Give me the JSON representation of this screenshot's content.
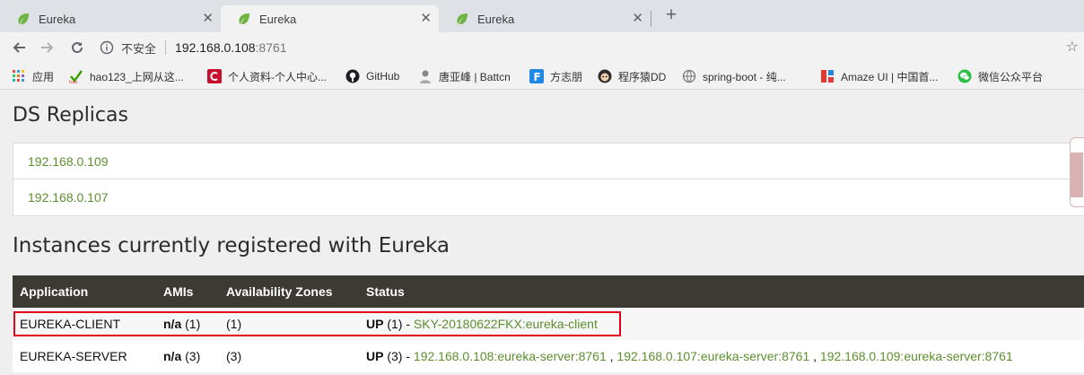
{
  "colors": {
    "accent_green": "#5d8f2e",
    "table_header_bg": "#3d3933",
    "highlight_red": "#e3001b"
  },
  "tabs": [
    {
      "title": "Eureka",
      "icon": "spring-leaf-icon"
    },
    {
      "title": "Eureka",
      "icon": "spring-leaf-icon",
      "active": true
    },
    {
      "title": "Eureka",
      "icon": "spring-leaf-icon"
    }
  ],
  "toolbar": {
    "security_label": "不安全",
    "url_host": "192.168.0.108",
    "url_port": ":8761"
  },
  "bookmarks": [
    {
      "label": "应用",
      "icon": "apps-grid-icon"
    },
    {
      "label": "hao123_上网从这...",
      "icon": "hao123-icon"
    },
    {
      "label": "个人资料-个人中心...",
      "icon": "csdn-icon"
    },
    {
      "label": "GitHub",
      "icon": "github-icon"
    },
    {
      "label": "唐亚峰 | Battcn",
      "icon": "avatar-icon"
    },
    {
      "label": "方志朋",
      "icon": "f-icon"
    },
    {
      "label": "程序猿DD",
      "icon": "avatar-icon"
    },
    {
      "label": "spring-boot - 纯...",
      "icon": "globe-icon"
    },
    {
      "label": "Amaze UI | 中国首...",
      "icon": "amaze-icon"
    },
    {
      "label": "微信公众平台",
      "icon": "wechat-icon"
    }
  ],
  "page": {
    "replicas_title": "DS Replicas",
    "replicas": [
      "192.168.0.109",
      "192.168.0.107"
    ],
    "instances_title": "Instances currently registered with Eureka",
    "columns": [
      "Application",
      "AMIs",
      "Availability Zones",
      "Status"
    ],
    "rows": [
      {
        "application": "EUREKA-CLIENT",
        "ami": "n/a",
        "ami_count": " (1)",
        "zones": "(1)",
        "status": "UP",
        "status_count": " (1) - ",
        "instances": [
          "SKY-20180622FKX:eureka-client"
        ]
      },
      {
        "application": "EUREKA-SERVER",
        "ami": "n/a",
        "ami_count": " (3)",
        "zones": "(3)",
        "status": "UP",
        "status_count": " (3) - ",
        "instances": [
          "192.168.0.108:eureka-server:8761",
          "192.168.0.107:eureka-server:8761",
          "192.168.0.109:eureka-server:8761"
        ],
        "separator": " , "
      }
    ]
  }
}
